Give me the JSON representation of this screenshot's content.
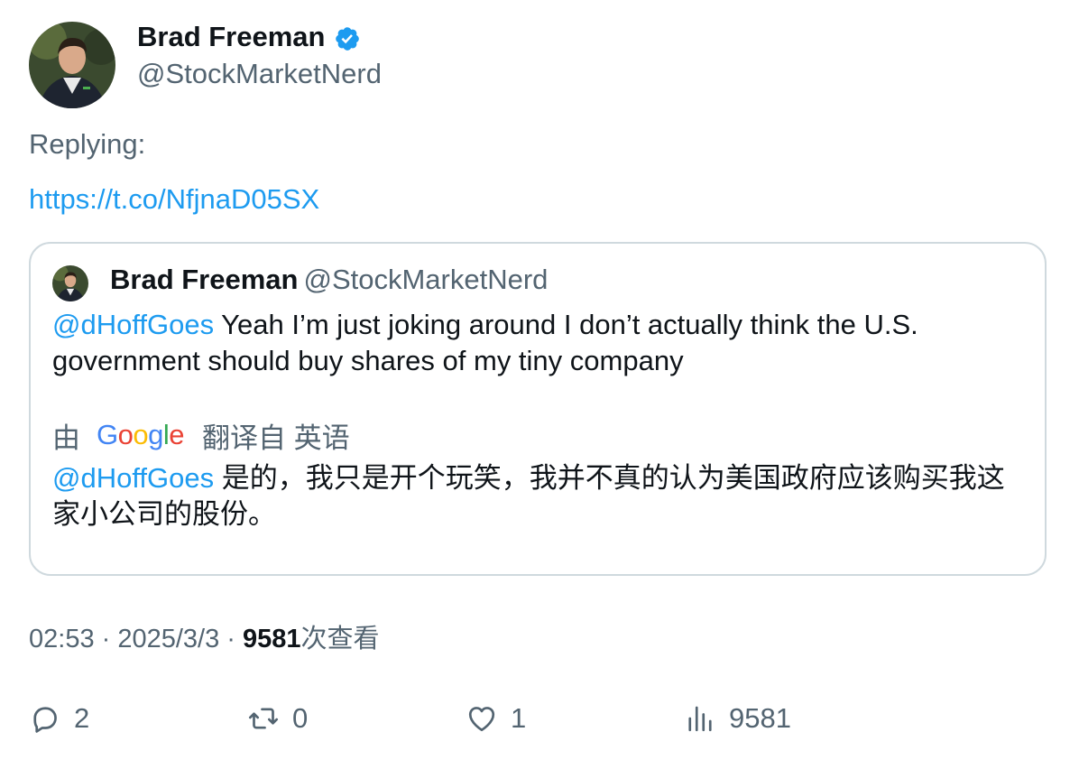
{
  "author": {
    "name": "Brad Freeman",
    "handle": "@StockMarketNerd",
    "verified": true
  },
  "replying_label": "Replying:",
  "link": "https://t.co/NfjnaD05SX",
  "quoted_tweet": {
    "name": "Brad Freeman",
    "handle": "@StockMarketNerd",
    "mention": "@dHoffGoes",
    "text": " Yeah I’m just joking around I don’t actually think the U.S. government should buy shares of my tiny company",
    "translation": {
      "by_label": "由",
      "provider": "Google",
      "from_label": "翻译自 英语",
      "mention": "@dHoffGoes",
      "text": " 是的，我只是开个玩笑，我并不真的认为美国政府应该购买我这家小公司的股份。"
    }
  },
  "meta": {
    "time": "02:53",
    "separator": " · ",
    "date": "2025/3/3",
    "views_count": "9581",
    "views_label": "次查看"
  },
  "actions": {
    "replies": "2",
    "retweets": "0",
    "likes": "1",
    "views": "9581"
  },
  "colors": {
    "accent": "#1d9bf0",
    "secondary_text": "#536471",
    "border": "#cfd9de"
  }
}
